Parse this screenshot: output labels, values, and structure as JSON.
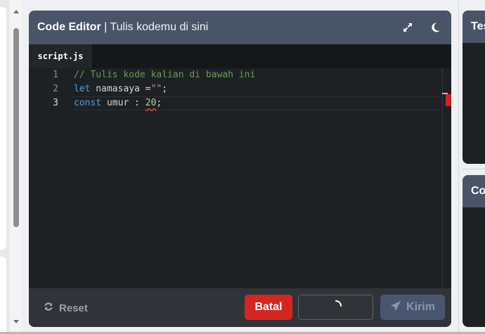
{
  "editor": {
    "title_bold": "Code Editor",
    "title_sep": " | ",
    "title_sub": "Tulis kodemu di sini",
    "expand_icon": "expand-icon",
    "theme_icon": "moon-icon",
    "tab": "script.js",
    "lines": [
      {
        "num": "1",
        "parts": [
          {
            "t": "// Tulis kode kalian di bawah ini",
            "c": "comment"
          }
        ]
      },
      {
        "num": "2",
        "parts": [
          {
            "t": "let",
            "c": "kw"
          },
          {
            "t": " namasaya =",
            "c": ""
          },
          {
            "t": "\"\"",
            "c": "str"
          },
          {
            "t": ";",
            "c": ""
          }
        ]
      },
      {
        "num": "3",
        "parts": [
          {
            "t": "const",
            "c": "kw"
          },
          {
            "t": " umur : ",
            "c": ""
          },
          {
            "t": "20",
            "c": "num"
          },
          {
            "t": ";",
            "c": ""
          }
        ]
      }
    ]
  },
  "footer": {
    "reset_label": "Reset",
    "batal_label": "Batal",
    "kirim_label": "Kirim"
  },
  "right": {
    "panel1_title": "Test",
    "panel2_title": "Con"
  },
  "colors": {
    "header": "#4a5468",
    "danger": "#d52521",
    "primary_disabled": "#4a5570"
  }
}
